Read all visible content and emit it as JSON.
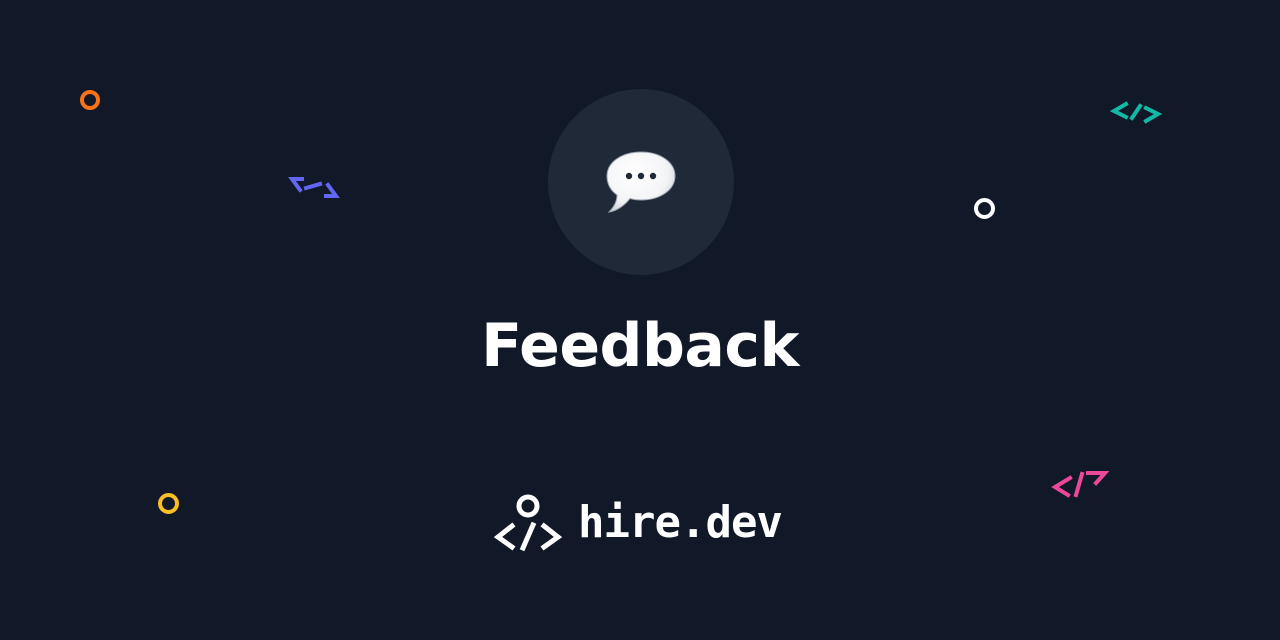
{
  "colors": {
    "background": "#111827",
    "icon_circle": "#1f2937",
    "text": "#ffffff",
    "accent_orange": "#f97316",
    "accent_yellow": "#fbbf24",
    "accent_purple": "#6366f1",
    "accent_teal": "#14b8a6",
    "accent_pink": "#ec4899"
  },
  "hero": {
    "icon": "speech-bubble-icon",
    "title": "Feedback"
  },
  "brand": {
    "icon": "hire-dev-logo-icon",
    "name": "hire.dev"
  },
  "decorations": [
    {
      "kind": "ring",
      "color": "#f97316"
    },
    {
      "kind": "ring",
      "color": "#ffffff"
    },
    {
      "kind": "ring",
      "color": "#fbbf24"
    },
    {
      "kind": "code-brackets",
      "color": "#6366f1"
    },
    {
      "kind": "code-brackets",
      "color": "#14b8a6"
    },
    {
      "kind": "code-brackets",
      "color": "#ec4899"
    }
  ]
}
